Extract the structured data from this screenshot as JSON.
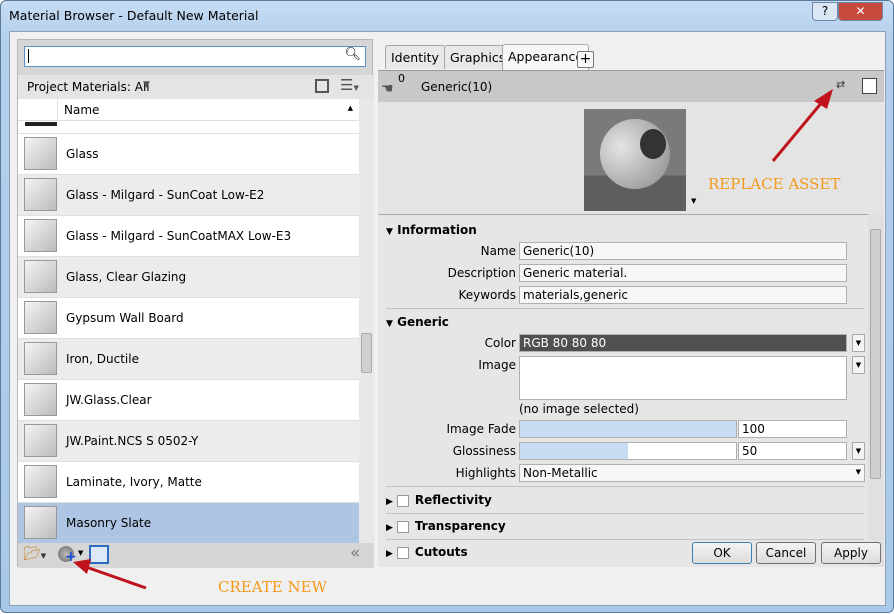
{
  "window": {
    "title": "Material Browser - Default New Material",
    "help": "?",
    "close": "✕"
  },
  "browser": {
    "search_placeholder": "",
    "library": "Project Materials: All",
    "column": "Name",
    "items": [
      {
        "name": "Glass"
      },
      {
        "name": "Glass - Milgard - SunCoat Low-E2"
      },
      {
        "name": "Glass - Milgard - SunCoatMAX Low-E3"
      },
      {
        "name": "Glass, Clear Glazing"
      },
      {
        "name": "Gypsum Wall Board"
      },
      {
        "name": "Iron, Ductile"
      },
      {
        "name": "JW.Glass.Clear"
      },
      {
        "name": "JW.Paint.NCS S 0502-Y"
      },
      {
        "name": "Laminate, Ivory, Matte"
      },
      {
        "name": "Masonry Slate",
        "selected": true
      }
    ]
  },
  "editor": {
    "tabs": [
      "Identity",
      "Graphics",
      "Appearance",
      "+"
    ],
    "active_tab": "Appearance",
    "asset_name": "Generic(10)",
    "asset_users": "0",
    "information": {
      "title": "Information",
      "name_label": "Name",
      "name": "Generic(10)",
      "desc_label": "Description",
      "desc": "Generic material.",
      "kw_label": "Keywords",
      "kw": "materials,generic"
    },
    "generic": {
      "title": "Generic",
      "color_label": "Color",
      "color": "RGB 80 80 80",
      "color_hex": "#505050",
      "image_label": "Image",
      "image_note": "(no image selected)",
      "fade_label": "Image Fade",
      "fade": "100",
      "gloss_label": "Glossiness",
      "gloss": "50",
      "hl_label": "Highlights",
      "hl": "Non-Metallic"
    },
    "sections": [
      "Reflectivity",
      "Transparency",
      "Cutouts"
    ]
  },
  "buttons": {
    "ok": "OK",
    "cancel": "Cancel",
    "apply": "Apply"
  },
  "annotations": {
    "replace": "REPLACE ASSET",
    "create": "CREATE NEW",
    "color": "#f39a1c",
    "arrow_color": "#c0141c"
  }
}
